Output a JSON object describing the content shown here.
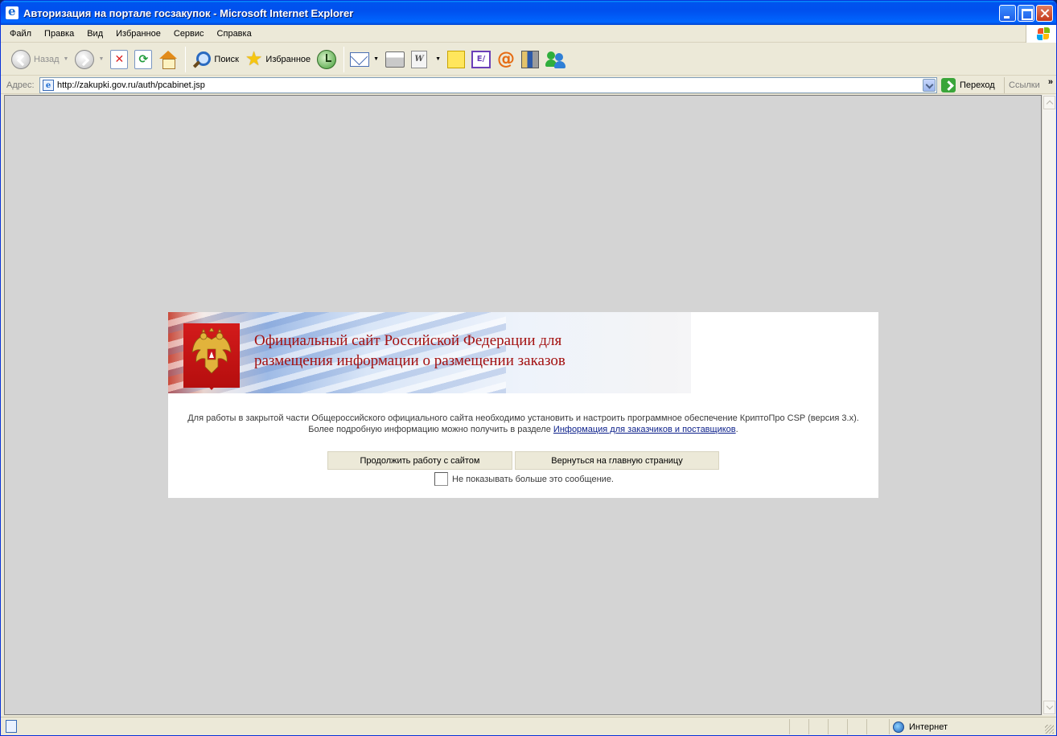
{
  "window": {
    "title": "Авторизация на портале госзакупок - Microsoft Internet Explorer"
  },
  "menu": [
    "Файл",
    "Правка",
    "Вид",
    "Избранное",
    "Сервис",
    "Справка"
  ],
  "toolbar": {
    "back_label": "Назад",
    "search_label": "Поиск",
    "favorites_label": "Избранное"
  },
  "address": {
    "label": "Адрес:",
    "url": "http://zakupki.gov.ru/auth/pcabinet.jsp",
    "go_label": "Переход",
    "links_label": "Ссылки"
  },
  "dialog": {
    "banner_title_line1": "Официальный сайт Российской Федерации для",
    "banner_title_line2": "размещения информации о размещении заказов",
    "text_line1": "Для работы в закрытой части Общероссийского официального сайта необходимо установить и настроить программное обеспечение КриптоПро CSP (версия 3.x).",
    "text_line2_prefix": "Более подробную информацию можно получить в разделе ",
    "text_link": "Информация для заказчиков и поставщиков",
    "text_line2_suffix": ".",
    "continue_label": "Продолжить работу с сайтом",
    "home_label": "Вернуться на главную страницу",
    "checkbox_label": "Не показывать больше это сообщение.",
    "checkbox_checked": false
  },
  "status": {
    "zone_label": "Интернет"
  },
  "colors": {
    "title_bar": "#0054e3",
    "banner_title": "#a31010",
    "emblem_red": "#c8141a",
    "link": "#0b1f8a",
    "page_background": "#d4d4d4"
  }
}
